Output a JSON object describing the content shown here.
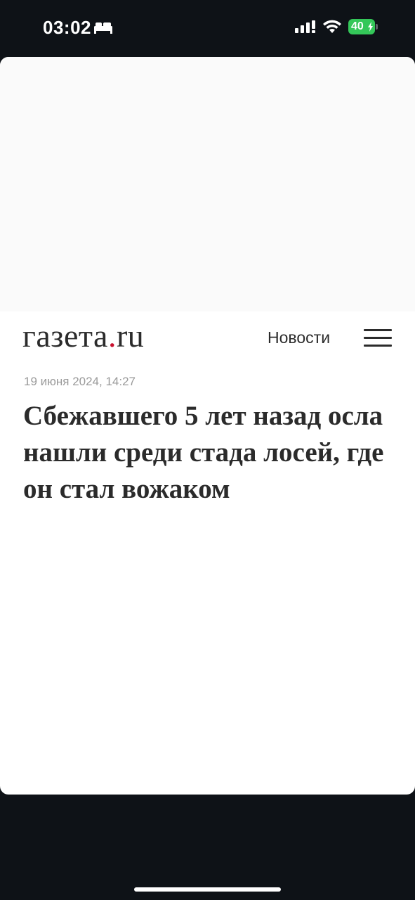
{
  "status_bar": {
    "time": "03:02",
    "battery_level": "40",
    "icons": [
      "sleep-focus-icon",
      "cellular-signal-icon",
      "wifi-icon",
      "battery-charging-icon"
    ],
    "battery_color": "#34c759"
  },
  "header": {
    "logo_main": "газета",
    "logo_dot": ".",
    "logo_tld": "ru",
    "logo_dot_color": "#c8102e",
    "nav_label": "Новости",
    "menu_icon": "hamburger-menu-icon"
  },
  "article": {
    "date": "19 июня 2024, 14:27",
    "title": "Сбежавшего 5 лет назад осла нашли среди стада лосей, где он стал вожаком"
  }
}
